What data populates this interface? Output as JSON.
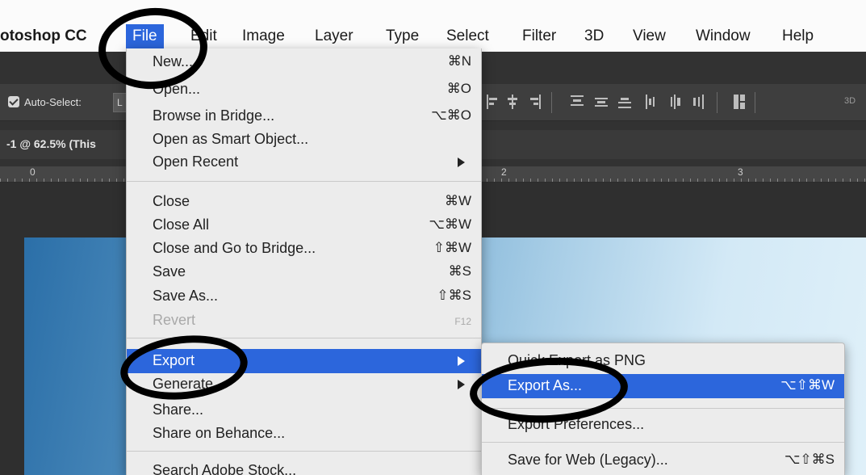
{
  "menubar": {
    "app_name": "otoshop CC",
    "items": [
      "File",
      "Edit",
      "Image",
      "Layer",
      "Type",
      "Select",
      "Filter",
      "3D",
      "View",
      "Window",
      "Help"
    ]
  },
  "options_bar": {
    "auto_select_label": "Auto-Select:",
    "auto_select_value": "L",
    "three_d_label": "3D"
  },
  "document": {
    "tab_label": "-1 @ 62.5% (This"
  },
  "ruler": {
    "labels": [
      "0",
      "2",
      "3"
    ]
  },
  "file_menu": {
    "items": [
      {
        "label": "New...",
        "shortcut": "⌘N"
      },
      {
        "label": "Open...",
        "shortcut": "⌘O"
      },
      {
        "label": "Browse in Bridge...",
        "shortcut": "⌥⌘O"
      },
      {
        "label": "Open as Smart Object...",
        "shortcut": ""
      },
      {
        "label": "Open Recent",
        "shortcut": ""
      },
      {
        "label": "Close",
        "shortcut": "⌘W"
      },
      {
        "label": "Close All",
        "shortcut": "⌥⌘W"
      },
      {
        "label": "Close and Go to Bridge...",
        "shortcut": "⇧⌘W"
      },
      {
        "label": "Save",
        "shortcut": "⌘S"
      },
      {
        "label": "Save As...",
        "shortcut": "⇧⌘S"
      },
      {
        "label": "Revert",
        "shortcut": "F12"
      },
      {
        "label": "Export",
        "shortcut": ""
      },
      {
        "label": "Generate",
        "shortcut": ""
      },
      {
        "label": "Share...",
        "shortcut": ""
      },
      {
        "label": "Share on Behance...",
        "shortcut": ""
      },
      {
        "label": "Search Adobe Stock...",
        "shortcut": ""
      }
    ]
  },
  "export_submenu": {
    "items": [
      {
        "label": "Quick Export as PNG",
        "shortcut": ""
      },
      {
        "label": "Export As...",
        "shortcut": "⌥⇧⌘W"
      },
      {
        "label": "Export Preferences...",
        "shortcut": ""
      },
      {
        "label": "Save for Web (Legacy)...",
        "shortcut": "⌥⇧⌘S"
      }
    ]
  },
  "colors": {
    "highlight": "#2c66dc",
    "menu_bg": "#ececec",
    "annotation": "#000000"
  }
}
